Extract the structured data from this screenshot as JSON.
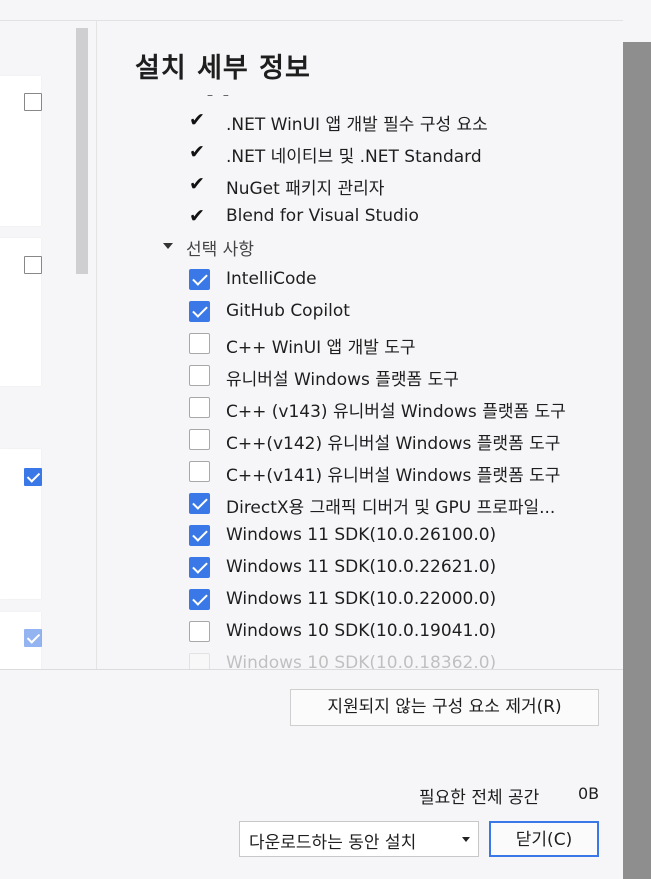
{
  "details": {
    "title": "설치 세부 정보",
    "truncated_marker": "– –",
    "included_items": [
      {
        "label": ".NET WinUI 앱 개발 필수 구성 요소",
        "checked": true
      },
      {
        "label": ".NET 네이티브 및 .NET Standard",
        "checked": true
      },
      {
        "label": "NuGet 패키지 관리자",
        "checked": true
      },
      {
        "label": "Blend for Visual Studio",
        "checked": true
      }
    ],
    "optional_section_label": "선택 사항",
    "optional_items": [
      {
        "label": "IntelliCode",
        "checked": true
      },
      {
        "label": "GitHub Copilot",
        "checked": true
      },
      {
        "label": "C++ WinUI 앱 개발 도구",
        "checked": false
      },
      {
        "label": "유니버설 Windows 플랫폼 도구",
        "checked": false
      },
      {
        "label": "C++ (v143) 유니버설 Windows 플랫폼 도구",
        "checked": false
      },
      {
        "label": "C++(v142) 유니버설 Windows 플랫폼 도구",
        "checked": false
      },
      {
        "label": "C++(v141) 유니버설 Windows 플랫폼 도구",
        "checked": false
      },
      {
        "label": "DirectX용 그래픽 디버거 및 GPU 프로파일...",
        "checked": true
      },
      {
        "label": "Windows 11 SDK(10.0.26100.0)",
        "checked": true
      },
      {
        "label": "Windows 11 SDK(10.0.22621.0)",
        "checked": true
      },
      {
        "label": "Windows 11 SDK(10.0.22000.0)",
        "checked": true
      },
      {
        "label": "Windows 10 SDK(10.0.19041.0)",
        "checked": false
      },
      {
        "label": "Windows 10 SDK(10.0.18362.0)",
        "checked": false
      }
    ]
  },
  "workload_cards": [
    {
      "checked": false
    },
    {
      "checked": false
    },
    {
      "checked": true
    },
    {
      "checked": true
    }
  ],
  "footer": {
    "remove_button": "지원되지 않는 구성 요소 제거(R)",
    "required_space_label": "필요한 전체 공간",
    "required_space_value": "0B",
    "install_mode": "다운로드하는 동안 설치",
    "close_button": "닫기(C)"
  },
  "colors": {
    "accent": "#3b78e7",
    "background": "#f6f6f8",
    "card": "#ffffff"
  }
}
